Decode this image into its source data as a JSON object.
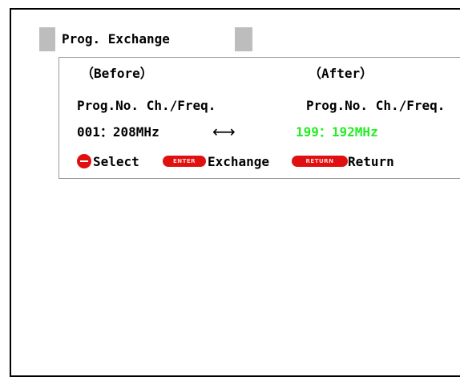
{
  "title": "Prog. Exchange",
  "before": {
    "header": "（Before）",
    "columns": "Prog.No. Ch./Freq.",
    "value": "001：208MHz"
  },
  "after": {
    "header": "（After）",
    "columns": "Prog.No. Ch./Freq.",
    "value": "199：192MHz",
    "value_color": "#22ee22"
  },
  "arrow": "⟷",
  "legend": {
    "select_label": "Select",
    "enter_key": "ENTER",
    "exchange_label": "Exchange",
    "return_key": "RETURN",
    "return_label": "Return"
  },
  "icons": {
    "select": "minus-circle-icon",
    "enter": "enter-key-icon",
    "return": "return-key-icon"
  },
  "colors": {
    "button_red": "#e01010",
    "title_bar_grey": "#bdbdbd"
  }
}
